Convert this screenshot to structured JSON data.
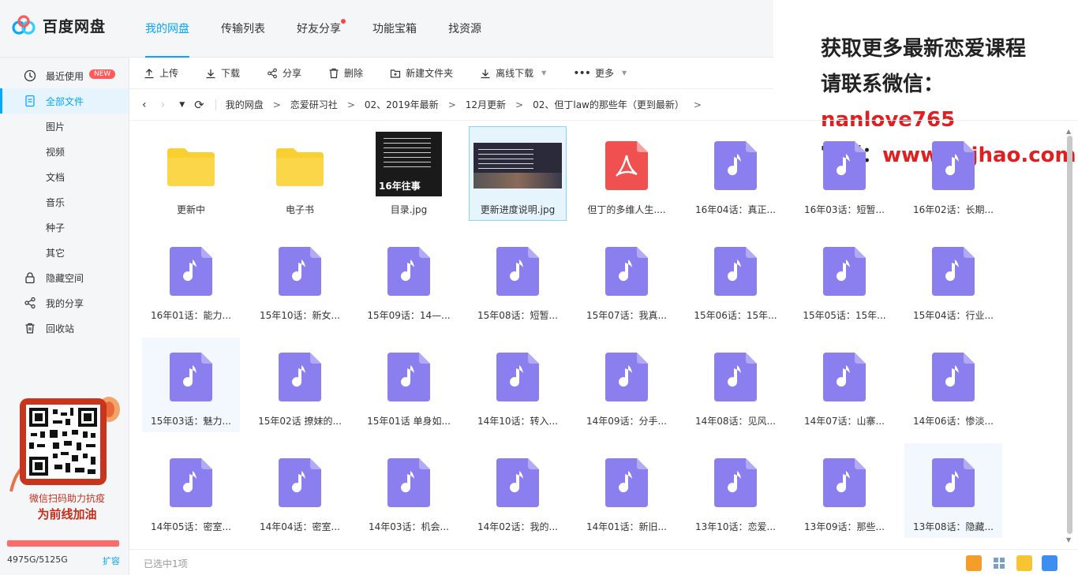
{
  "app": {
    "name": "百度网盘"
  },
  "nav": {
    "tabs": [
      "我的网盘",
      "传输列表",
      "好友分享",
      "功能宝箱",
      "找资源"
    ]
  },
  "promo": {
    "line1": "获取更多最新恋爱课程",
    "line2_label": "请联系微信：",
    "line2_value": "nanlove765",
    "line3_label": "官网：",
    "line3_value": "www.xsjhao.com"
  },
  "sidebar": {
    "items": [
      {
        "label": "最近使用",
        "badge": "NEW"
      },
      {
        "label": "全部文件"
      },
      {
        "label": "图片"
      },
      {
        "label": "视频"
      },
      {
        "label": "文档"
      },
      {
        "label": "音乐"
      },
      {
        "label": "种子"
      },
      {
        "label": "其它"
      },
      {
        "label": "隐藏空间"
      },
      {
        "label": "我的分享"
      },
      {
        "label": "回收站"
      }
    ],
    "qr_caption1": "微信扫码助力抗疫",
    "qr_caption2": "为前线加油",
    "quota": "4975G/5125G",
    "expand": "扩容"
  },
  "toolbar": {
    "upload": "上传",
    "download": "下载",
    "share": "分享",
    "delete": "删除",
    "new_folder": "新建文件夹",
    "offline": "离线下载",
    "more": "更多"
  },
  "breadcrumb": [
    "我的网盘",
    "恋爱研习社",
    "02、2019年最新",
    "12月更新",
    "02、但丁law的那些年（更到最新）"
  ],
  "files": [
    {
      "name": "更新中",
      "type": "folder"
    },
    {
      "name": "电子书",
      "type": "folder"
    },
    {
      "name": "目录.jpg",
      "type": "image"
    },
    {
      "name": "更新进度说明.jpg",
      "type": "image-wide"
    },
    {
      "name": "但丁的多维人生....",
      "type": "pdf"
    },
    {
      "name": "16年04话：真正...",
      "type": "audio"
    },
    {
      "name": "16年03话：短暂...",
      "type": "audio"
    },
    {
      "name": "16年02话：长期...",
      "type": "audio"
    },
    {
      "name": "16年01话：能力...",
      "type": "audio"
    },
    {
      "name": "15年10话：新女...",
      "type": "audio"
    },
    {
      "name": "15年09话：14—...",
      "type": "audio"
    },
    {
      "name": "15年08话：短暂...",
      "type": "audio"
    },
    {
      "name": "15年07话：我真...",
      "type": "audio"
    },
    {
      "name": "15年06话：15年...",
      "type": "audio"
    },
    {
      "name": "15年05话：15年...",
      "type": "audio"
    },
    {
      "name": "15年04话：行业...",
      "type": "audio"
    },
    {
      "name": "15年03话：魅力...",
      "type": "audio"
    },
    {
      "name": "15年02话 撩妹的...",
      "type": "audio"
    },
    {
      "name": "15年01话 单身如...",
      "type": "audio"
    },
    {
      "name": "14年10话：转入...",
      "type": "audio"
    },
    {
      "name": "14年09话：分手...",
      "type": "audio"
    },
    {
      "name": "14年08话：见风...",
      "type": "audio"
    },
    {
      "name": "14年07话：山寨...",
      "type": "audio"
    },
    {
      "name": "14年06话：惨淡...",
      "type": "audio"
    },
    {
      "name": "14年05话：密室...",
      "type": "audio"
    },
    {
      "name": "14年04话：密室...",
      "type": "audio"
    },
    {
      "name": "14年03话：机会...",
      "type": "audio"
    },
    {
      "name": "14年02话：我的...",
      "type": "audio"
    },
    {
      "name": "14年01话：新旧...",
      "type": "audio"
    },
    {
      "name": "13年10话：恋爱...",
      "type": "audio"
    },
    {
      "name": "13年09话：那些...",
      "type": "audio"
    },
    {
      "name": "13年08话：隐藏...",
      "type": "audio"
    }
  ],
  "image_thumb_text": "16年往事",
  "status": "已选中1项",
  "colors": {
    "accent": "#06a7ff",
    "audio": "#8b7ff0",
    "folder": "#f9cf31",
    "pdf": "#f0504f"
  }
}
